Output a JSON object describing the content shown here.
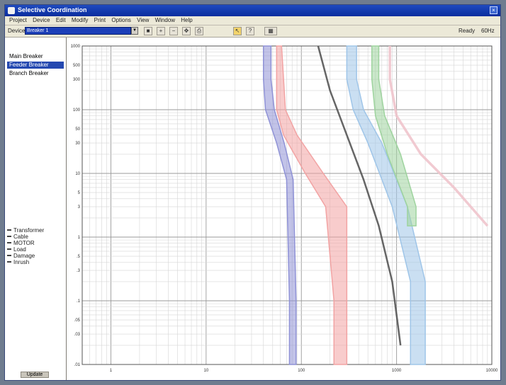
{
  "window": {
    "title": "Selective Coordination"
  },
  "menu": [
    "Project",
    "Device",
    "Edit",
    "Modify",
    "Print",
    "Options",
    "View",
    "Window",
    "Help"
  ],
  "toolbar": {
    "device_label": "Device",
    "device_value": "Breaker 1",
    "buttons": [
      "save-icon",
      "zoom-in-icon",
      "zoom-out-icon",
      "pan-icon",
      "print-icon",
      "cursor-icon",
      "help-icon"
    ],
    "right_a": "Ready",
    "right_b": "60Hz"
  },
  "sidebar": {
    "items": [
      {
        "label": "Main Breaker",
        "selected": false
      },
      {
        "label": "Feeder Breaker",
        "selected": true
      },
      {
        "label": "Branch Breaker",
        "selected": false
      }
    ],
    "legend": [
      {
        "label": "Transformer",
        "color": "#444444"
      },
      {
        "label": "Cable",
        "color": "#444444"
      },
      {
        "label": "MOTOR",
        "color": "#444444"
      },
      {
        "label": "Load",
        "color": "#444444"
      },
      {
        "label": "Damage",
        "color": "#444444"
      },
      {
        "label": "Inrush",
        "color": "#444444"
      }
    ],
    "footer": "Update"
  },
  "chart_data": {
    "type": "line",
    "title": "",
    "xlabel": "",
    "ylabel": "",
    "x_scale": "log",
    "y_scale": "log",
    "xlim": [
      0.5,
      10000
    ],
    "ylim": [
      0.01,
      1000
    ],
    "y_ticks": [
      "1000",
      "500",
      "300",
      "100",
      "50",
      "30",
      "10",
      "5",
      "3",
      "1",
      ".5",
      ".3",
      ".1",
      ".05",
      ".03",
      ".01"
    ],
    "x_ticks": [
      "1",
      "10",
      "100",
      "1000",
      "10000"
    ],
    "grid": true,
    "series": [
      {
        "color": "#8f92d6",
        "band": true,
        "x_lo": [
          40,
          40,
          42,
          55,
          70,
          75,
          75
        ],
        "x_hi": [
          48,
          48,
          52,
          66,
          82,
          88,
          88
        ],
        "y": [
          1000,
          300,
          100,
          30,
          8,
          0.1,
          0.01
        ]
      },
      {
        "color": "#f2a3a3",
        "band": true,
        "x_lo": [
          55,
          55,
          65,
          110,
          180,
          220,
          220
        ],
        "x_hi": [
          62,
          68,
          90,
          170,
          300,
          300,
          300
        ],
        "y": [
          1000,
          100,
          40,
          10,
          3,
          0.1,
          0.01
        ]
      },
      {
        "color": "#555555",
        "band": false,
        "x": [
          150,
          200,
          300,
          450,
          650,
          900,
          1100
        ],
        "y": [
          1000,
          200,
          40,
          8,
          1.5,
          0.2,
          0.02
        ]
      },
      {
        "color": "#9fc5e8",
        "band": true,
        "x_lo": [
          300,
          300,
          350,
          500,
          900,
          1400,
          1400
        ],
        "x_hi": [
          380,
          380,
          450,
          700,
          1300,
          2000,
          2000
        ],
        "y": [
          1000,
          300,
          100,
          30,
          3,
          0.2,
          0.01
        ]
      },
      {
        "color": "#9ed39e",
        "band": true,
        "x_lo": [
          550,
          550,
          600,
          800,
          1300,
          1300
        ],
        "x_hi": [
          650,
          650,
          750,
          1100,
          1600,
          1600
        ],
        "y": [
          1000,
          300,
          80,
          20,
          3,
          1.5
        ]
      },
      {
        "color": "#f0c4cc",
        "band": false,
        "x": [
          850,
          850,
          1000,
          1800,
          4000,
          9000
        ],
        "y": [
          1000,
          300,
          80,
          20,
          6,
          1.5
        ]
      }
    ]
  }
}
